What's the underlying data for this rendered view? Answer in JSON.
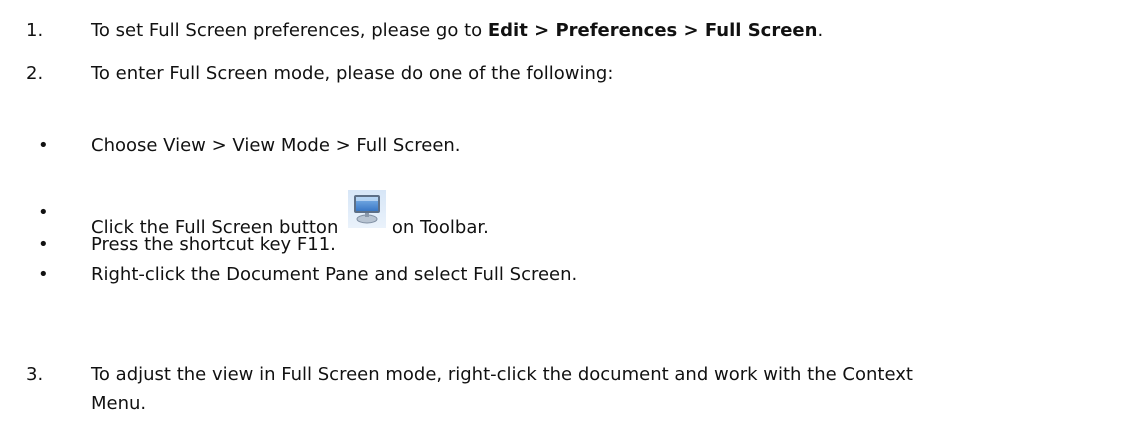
{
  "items": [
    {
      "number": "1.",
      "text_before": "To set Full Screen preferences, please go to ",
      "bold_text": "Edit > Preferences > Full Screen",
      "text_after": "."
    },
    {
      "number": "2.",
      "text": "To enter Full Screen mode, please do one of the following:"
    },
    {
      "number": "3.",
      "text_line1": "To adjust the view in Full Screen mode, right-click the document and work with the Context",
      "text_line2": "Menu."
    }
  ],
  "bullets": [
    {
      "symbol": "•",
      "text": "Choose View > View Mode > Full Screen."
    },
    {
      "symbol": "•",
      "text_before": "Click the Full Screen button",
      "icon": "full-screen-monitor-icon",
      "text_after": "on Toolbar."
    },
    {
      "symbol": "•",
      "text": "Press the shortcut key F11."
    },
    {
      "symbol": "•",
      "text": "Right-click the Document Pane and select Full Screen."
    }
  ]
}
